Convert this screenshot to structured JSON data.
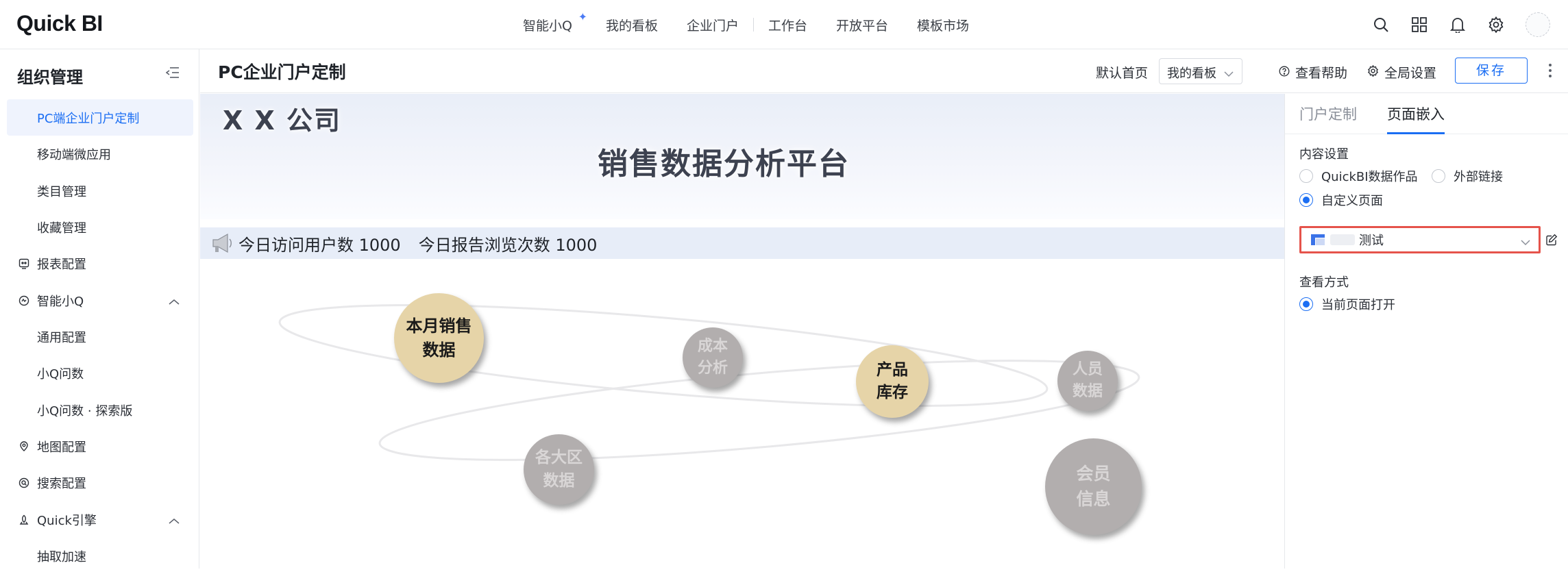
{
  "topbar": {
    "logo": "Quick BI",
    "nav": [
      {
        "label": "智能小Q"
      },
      {
        "label": "我的看板"
      },
      {
        "label": "企业门户"
      },
      {
        "label": "工作台"
      },
      {
        "label": "开放平台"
      },
      {
        "label": "模板市场"
      }
    ],
    "icons": [
      "search-icon",
      "apps-grid-icon",
      "bell-icon",
      "gear-icon",
      "avatar"
    ]
  },
  "sidebar": {
    "title": "组织管理",
    "items": [
      {
        "label": "PC端企业门户定制",
        "active": true
      },
      {
        "label": "移动端微应用"
      },
      {
        "label": "类目管理"
      },
      {
        "label": "收藏管理"
      },
      {
        "label": "报表配置",
        "icon": "report-icon"
      },
      {
        "label": "智能小Q",
        "icon": "ai-icon",
        "expanded": true
      },
      {
        "label": "通用配置"
      },
      {
        "label": "小Q问数"
      },
      {
        "label": "小Q问数 · 探索版"
      },
      {
        "label": "地图配置",
        "icon": "map-icon"
      },
      {
        "label": "搜索配置",
        "icon": "search-config-icon"
      },
      {
        "label": "Quick引擎",
        "icon": "engine-icon",
        "expanded": true
      },
      {
        "label": "抽取加速"
      }
    ]
  },
  "pagebar": {
    "title": "PC企业门户定制",
    "default_label": "默认首页",
    "default_value": "我的看板",
    "help": "查看帮助",
    "global": "全局设置",
    "save": "保存"
  },
  "canvas": {
    "company": "X X 公司",
    "platform": "销售数据分析平台",
    "ticker": [
      "今日访问用户数 1000",
      "今日报告浏览次数 1000"
    ],
    "bubbles": [
      {
        "line1": "本月销售",
        "line2": "数据",
        "style": "gold"
      },
      {
        "line1": "成本",
        "line2": "分析",
        "style": "grey"
      },
      {
        "line1": "产品",
        "line2": "库存",
        "style": "gold"
      },
      {
        "line1": "人员",
        "line2": "数据",
        "style": "grey"
      },
      {
        "line1": "各大区",
        "line2": "数据",
        "style": "grey"
      },
      {
        "line1": "会员",
        "line2": "信息",
        "style": "grey"
      }
    ]
  },
  "rpanel": {
    "tabs": [
      {
        "label": "门户定制",
        "active": false
      },
      {
        "label": "页面嵌入",
        "active": true
      }
    ],
    "content_label": "内容设置",
    "content_options": [
      {
        "label": "QuickBI数据作品",
        "checked": false
      },
      {
        "label": "外部链接",
        "checked": false
      },
      {
        "label": "自定义页面",
        "checked": true
      }
    ],
    "picker_value": "测试",
    "view_label": "查看方式",
    "view_options": [
      {
        "label": "当前页面打开",
        "checked": true
      }
    ]
  },
  "colors": {
    "accent": "#1b6ef3",
    "highlight_border": "#e5534b",
    "bubble_gold": "#e6d4a8",
    "bubble_grey": "#b2aeae"
  }
}
